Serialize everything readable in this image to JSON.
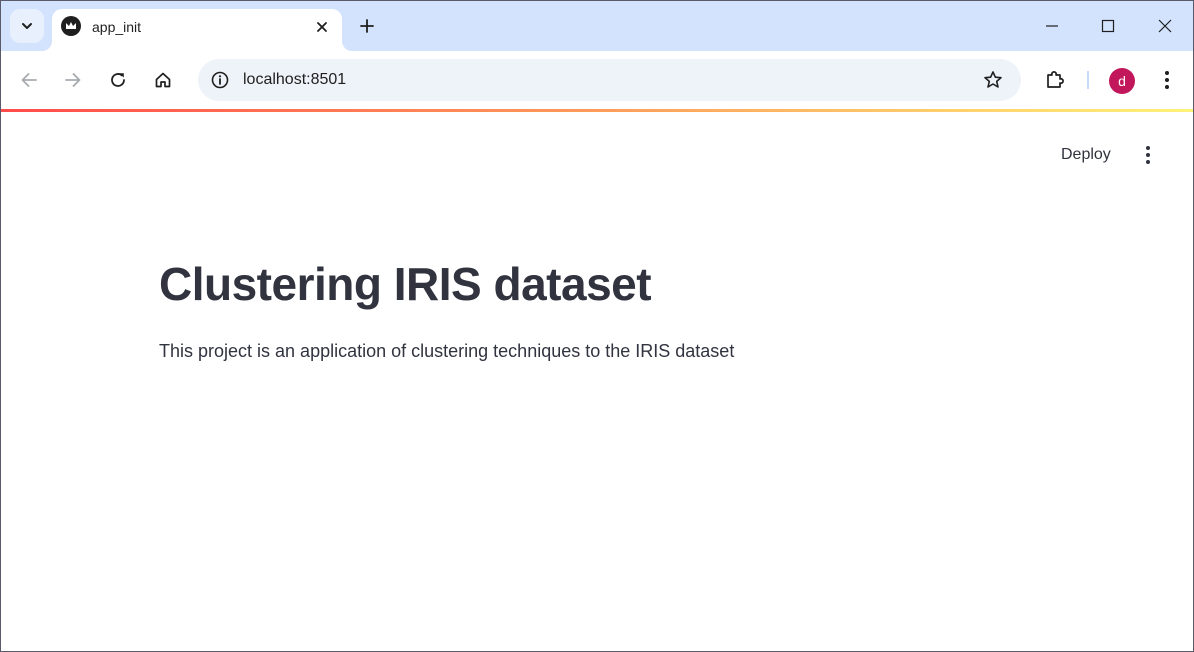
{
  "browser": {
    "tab": {
      "title": "app_init"
    },
    "address_bar": {
      "url": "localhost:8501"
    },
    "profile": {
      "initial": "d",
      "color": "#c2185b"
    },
    "colors": {
      "tab_strip": "#d3e3fd",
      "omnibox": "#eef2f9"
    }
  },
  "app": {
    "toolbar": {
      "deploy_label": "Deploy"
    },
    "title": "Clustering IRIS dataset",
    "description": "This project is an application of clustering techniques to the IRIS dataset",
    "colors": {
      "text": "#31333f",
      "decoration_start": "#ff4b4b",
      "decoration_end": "#fff27a"
    }
  }
}
